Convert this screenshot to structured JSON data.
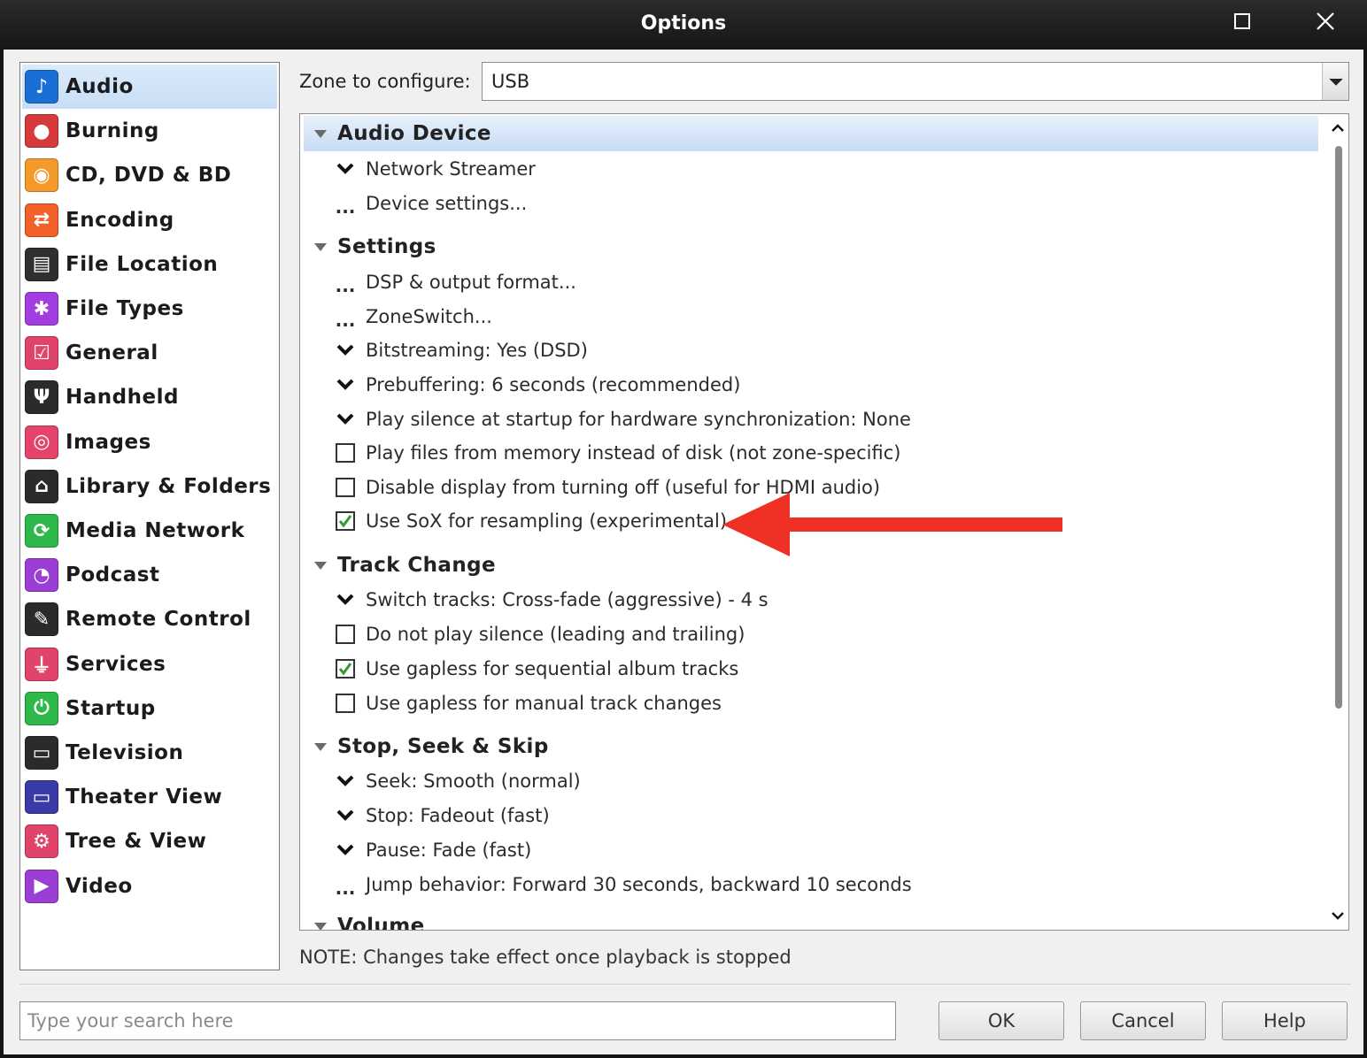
{
  "window": {
    "title": "Options",
    "maximize_icon": "maximize-icon",
    "close_icon": "close-icon"
  },
  "sidebar": {
    "items": [
      {
        "label": "Audio",
        "icon": "music-note-icon",
        "color": "#1a6fd6",
        "glyph": "♪",
        "selected": true
      },
      {
        "label": "Burning",
        "icon": "burn-disc-icon",
        "color": "#d63a3a",
        "glyph": "●"
      },
      {
        "label": "CD, DVD & BD",
        "icon": "disc-icon",
        "color": "#f39a2b",
        "glyph": "◉"
      },
      {
        "label": "Encoding",
        "icon": "encoding-arrows-icon",
        "color": "#f2612b",
        "glyph": "⇄"
      },
      {
        "label": "File Location",
        "icon": "file-location-icon",
        "color": "#2f2f2f",
        "glyph": "▤"
      },
      {
        "label": "File Types",
        "icon": "file-types-icon",
        "color": "#a23ee0",
        "glyph": "✱"
      },
      {
        "label": "General",
        "icon": "general-checkbox-icon",
        "color": "#e0446a",
        "glyph": "☑"
      },
      {
        "label": "Handheld",
        "icon": "usb-icon",
        "color": "#2b2b2b",
        "glyph": "Ψ"
      },
      {
        "label": "Images",
        "icon": "camera-icon",
        "color": "#e5436a",
        "glyph": "◎"
      },
      {
        "label": "Library & Folders",
        "icon": "library-house-icon",
        "color": "#2b2b2b",
        "glyph": "⌂"
      },
      {
        "label": "Media Network",
        "icon": "media-network-icon",
        "color": "#2fb84a",
        "glyph": "⟳"
      },
      {
        "label": "Podcast",
        "icon": "podcast-icon",
        "color": "#9b3ed6",
        "glyph": "◔"
      },
      {
        "label": "Remote Control",
        "icon": "remote-control-icon",
        "color": "#2b2b2b",
        "glyph": "✎"
      },
      {
        "label": "Services",
        "icon": "plug-icon",
        "color": "#e0446a",
        "glyph": "⏚"
      },
      {
        "label": "Startup",
        "icon": "power-icon",
        "color": "#2fb84a",
        "glyph": "⏻"
      },
      {
        "label": "Television",
        "icon": "television-icon",
        "color": "#2b2b2b",
        "glyph": "▭"
      },
      {
        "label": "Theater View",
        "icon": "theater-view-icon",
        "color": "#3a3aa8",
        "glyph": "▭"
      },
      {
        "label": "Tree & View",
        "icon": "tree-view-gear-icon",
        "color": "#e0446a",
        "glyph": "⚙"
      },
      {
        "label": "Video",
        "icon": "video-camera-icon",
        "color": "#9b3ed6",
        "glyph": "▶"
      }
    ]
  },
  "zone": {
    "label": "Zone to configure:",
    "value": "USB",
    "dropdown_icon": "chevron-down-icon"
  },
  "tree": {
    "sections": [
      {
        "title": "Audio Device",
        "rows": [
          {
            "kind": "dropdown",
            "label": "Network Streamer"
          },
          {
            "kind": "dialog",
            "label": "Device settings..."
          }
        ]
      },
      {
        "title": "Settings",
        "rows": [
          {
            "kind": "dialog",
            "label": "DSP & output format..."
          },
          {
            "kind": "dialog",
            "label": "ZoneSwitch..."
          },
          {
            "kind": "dropdown",
            "label": "Bitstreaming: Yes (DSD)"
          },
          {
            "kind": "dropdown",
            "label": "Prebuffering: 6 seconds (recommended)"
          },
          {
            "kind": "dropdown",
            "label": "Play silence at startup for hardware synchronization: None"
          },
          {
            "kind": "checkbox",
            "checked": false,
            "label": "Play files from memory instead of disk (not zone-specific)"
          },
          {
            "kind": "checkbox",
            "checked": false,
            "label": "Disable display from turning off (useful for HDMI audio)"
          },
          {
            "kind": "checkbox",
            "checked": true,
            "label": "Use SoX for resampling (experimental)"
          }
        ]
      },
      {
        "title": "Track Change",
        "rows": [
          {
            "kind": "dropdown",
            "label": "Switch tracks: Cross-fade (aggressive) - 4 s"
          },
          {
            "kind": "checkbox",
            "checked": false,
            "label": "Do not play silence (leading and trailing)"
          },
          {
            "kind": "checkbox",
            "checked": true,
            "label": "Use gapless for sequential album tracks"
          },
          {
            "kind": "checkbox",
            "checked": false,
            "label": "Use gapless for manual track changes"
          }
        ]
      },
      {
        "title": "Stop, Seek & Skip",
        "rows": [
          {
            "kind": "dropdown",
            "label": "Seek: Smooth (normal)"
          },
          {
            "kind": "dropdown",
            "label": "Stop: Fadeout (fast)"
          },
          {
            "kind": "dropdown",
            "label": "Pause: Fade (fast)"
          },
          {
            "kind": "dialog",
            "label": "Jump behavior: Forward 30 seconds, backward 10 seconds"
          }
        ]
      },
      {
        "title": "Volume",
        "rows": []
      }
    ],
    "scroll_up_icon": "scroll-up-icon",
    "scroll_down_icon": "scroll-down-icon"
  },
  "note": "NOTE: Changes take effect once playback is stopped",
  "search": {
    "placeholder": "Type your search here",
    "value": ""
  },
  "buttons": {
    "ok": "OK",
    "cancel": "Cancel",
    "help": "Help"
  },
  "annotation": {
    "icon": "red-arrow-icon",
    "color": "#ee3124"
  },
  "colors": {
    "titlebar": "#1e1e1e",
    "selection": "#cfe2f8",
    "check_green": "#2f9a2f"
  }
}
